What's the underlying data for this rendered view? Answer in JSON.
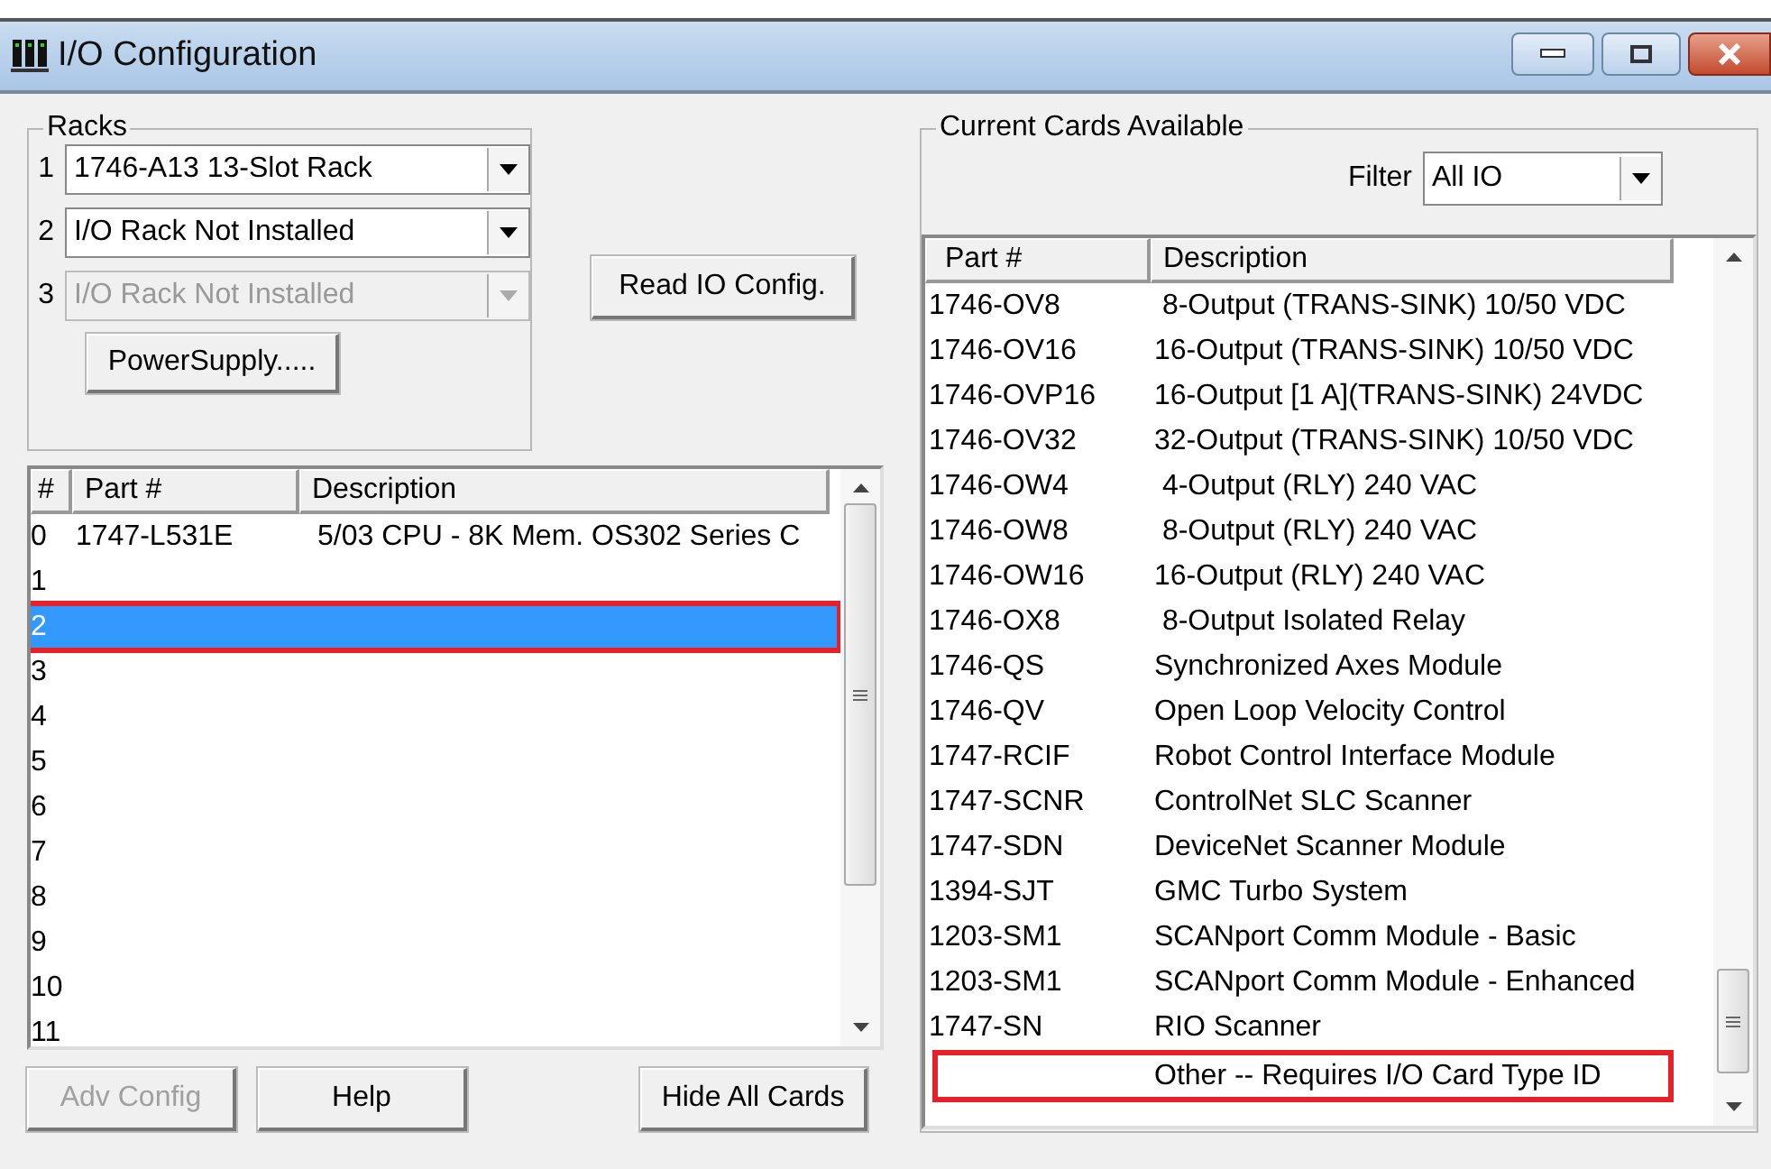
{
  "window": {
    "title": "I/O Configuration"
  },
  "racks": {
    "label": "Racks",
    "items": [
      {
        "number": "1",
        "value": "1746-A13  13-Slot Rack",
        "disabled": false
      },
      {
        "number": "2",
        "value": "I/O Rack Not Installed",
        "disabled": false
      },
      {
        "number": "3",
        "value": "I/O Rack Not Installed",
        "disabled": true
      }
    ],
    "power_button": "PowerSupply....."
  },
  "read_button": "Read IO Config.",
  "slots": {
    "columns": [
      "#",
      "Part #",
      "Description"
    ],
    "rows": [
      {
        "slot": "0",
        "part": "1747-L531E",
        "description": "5/03 CPU - 8K  Mem. OS302 Series C",
        "selected": false,
        "highlighted": false
      },
      {
        "slot": "1",
        "part": "",
        "description": "",
        "selected": false,
        "highlighted": false
      },
      {
        "slot": "2",
        "part": "",
        "description": "",
        "selected": true,
        "highlighted": true
      },
      {
        "slot": "3",
        "part": "",
        "description": "",
        "selected": false,
        "highlighted": false
      },
      {
        "slot": "4",
        "part": "",
        "description": "",
        "selected": false,
        "highlighted": false
      },
      {
        "slot": "5",
        "part": "",
        "description": "",
        "selected": false,
        "highlighted": false
      },
      {
        "slot": "6",
        "part": "",
        "description": "",
        "selected": false,
        "highlighted": false
      },
      {
        "slot": "7",
        "part": "",
        "description": "",
        "selected": false,
        "highlighted": false
      },
      {
        "slot": "8",
        "part": "",
        "description": "",
        "selected": false,
        "highlighted": false
      },
      {
        "slot": "9",
        "part": "",
        "description": "",
        "selected": false,
        "highlighted": false
      },
      {
        "slot": "10",
        "part": "",
        "description": "",
        "selected": false,
        "highlighted": false
      },
      {
        "slot": "11",
        "part": "",
        "description": "",
        "selected": false,
        "highlighted": false
      }
    ]
  },
  "bottom_buttons": [
    {
      "label": "Adv Config",
      "disabled": true
    },
    {
      "label": "Help",
      "disabled": false
    },
    {
      "label": "Hide All Cards",
      "disabled": false
    }
  ],
  "cards": {
    "label": "Current Cards Available",
    "filter_label": "Filter",
    "filter_value": "All IO",
    "columns": [
      "Part #",
      "Description"
    ],
    "rows": [
      {
        "part": "1746-OV8",
        "description": " 8-Output (TRANS-SINK) 10/50 VDC",
        "highlighted": false
      },
      {
        "part": "1746-OV16",
        "description": "16-Output (TRANS-SINK) 10/50 VDC",
        "highlighted": false
      },
      {
        "part": "1746-OVP16",
        "description": "16-Output [1 A](TRANS-SINK) 24VDC",
        "highlighted": false
      },
      {
        "part": "1746-OV32",
        "description": "32-Output (TRANS-SINK) 10/50 VDC",
        "highlighted": false
      },
      {
        "part": "1746-OW4",
        "description": " 4-Output (RLY) 240 VAC",
        "highlighted": false
      },
      {
        "part": "1746-OW8",
        "description": " 8-Output (RLY) 240 VAC",
        "highlighted": false
      },
      {
        "part": "1746-OW16",
        "description": "16-Output (RLY) 240 VAC",
        "highlighted": false
      },
      {
        "part": "1746-OX8",
        "description": " 8-Output Isolated Relay",
        "highlighted": false
      },
      {
        "part": "1746-QS",
        "description": "Synchronized Axes Module",
        "highlighted": false
      },
      {
        "part": "1746-QV",
        "description": "Open Loop Velocity Control",
        "highlighted": false
      },
      {
        "part": "1747-RCIF",
        "description": "Robot Control Interface Module",
        "highlighted": false
      },
      {
        "part": "1747-SCNR",
        "description": "ControlNet SLC Scanner",
        "highlighted": false
      },
      {
        "part": "1747-SDN",
        "description": "DeviceNet Scanner Module",
        "highlighted": false
      },
      {
        "part": "1394-SJT",
        "description": "GMC Turbo System",
        "highlighted": false
      },
      {
        "part": "1203-SM1",
        "description": "SCANport Comm Module - Basic",
        "highlighted": false
      },
      {
        "part": "1203-SM1",
        "description": "SCANport Comm Module - Enhanced",
        "highlighted": false
      },
      {
        "part": "1747-SN",
        "description": "RIO Scanner",
        "highlighted": false
      },
      {
        "part": "",
        "description": "Other -- Requires I/O Card Type ID",
        "highlighted": true
      }
    ]
  }
}
